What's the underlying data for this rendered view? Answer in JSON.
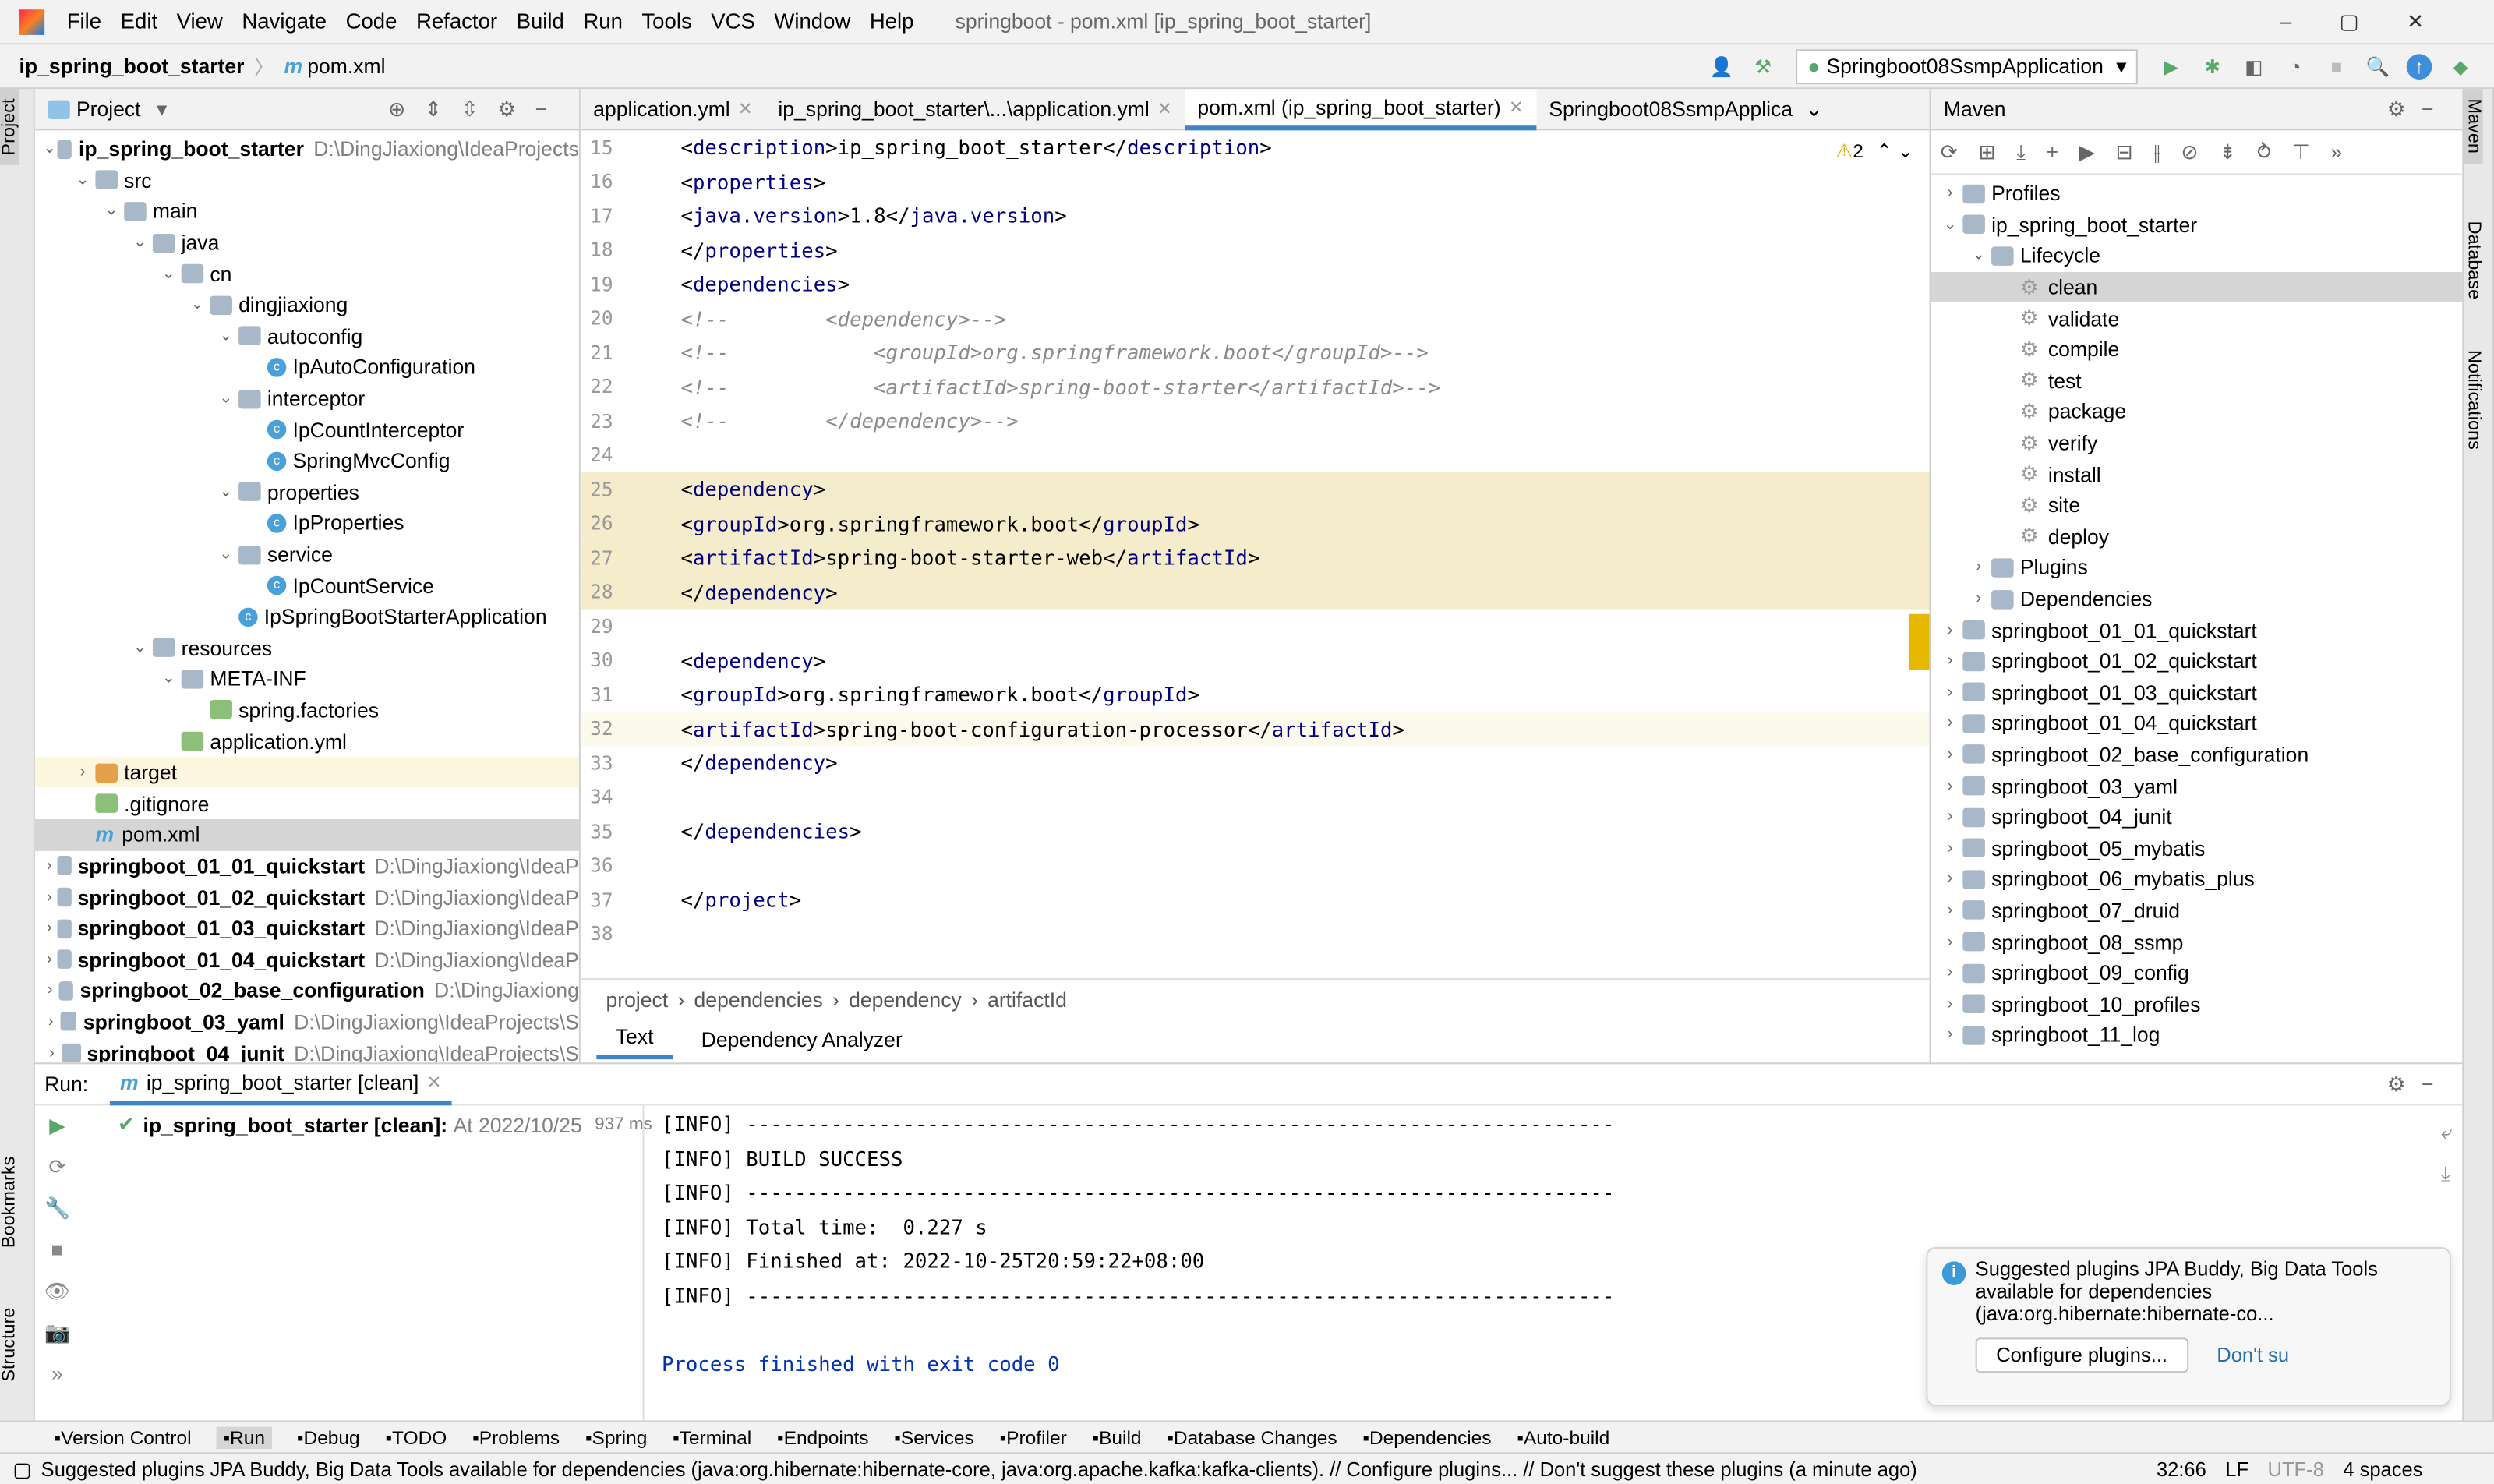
{
  "menu": [
    "File",
    "Edit",
    "View",
    "Navigate",
    "Code",
    "Refactor",
    "Build",
    "Run",
    "Tools",
    "VCS",
    "Window",
    "Help"
  ],
  "window_title": "springboot - pom.xml [ip_spring_boot_starter]",
  "breadcrumb": {
    "project": "ip_spring_boot_starter",
    "file": "pom.xml"
  },
  "run_config": "Springboot08SsmpApplication",
  "left_stripe": {
    "project": "Project",
    "bookmarks": "Bookmarks",
    "structure": "Structure"
  },
  "right_stripe": {
    "maven": "Maven",
    "database": "Database",
    "notifications": "Notifications"
  },
  "project_panel": {
    "title": "Project",
    "tree": [
      {
        "d": 0,
        "o": "v",
        "i": "folder",
        "t": "ip_spring_boot_starter",
        "b": true,
        "p": "D:\\DingJiaxiong\\IdeaProjects"
      },
      {
        "d": 1,
        "o": "v",
        "i": "folder",
        "t": "src"
      },
      {
        "d": 2,
        "o": "v",
        "i": "folder",
        "t": "main"
      },
      {
        "d": 3,
        "o": "v",
        "i": "folder",
        "t": "java"
      },
      {
        "d": 4,
        "o": "v",
        "i": "folder",
        "t": "cn"
      },
      {
        "d": 5,
        "o": "v",
        "i": "folder",
        "t": "dingjiaxiong"
      },
      {
        "d": 6,
        "o": "v",
        "i": "folder",
        "t": "autoconfig"
      },
      {
        "d": 7,
        "o": "",
        "i": "class",
        "t": "IpAutoConfiguration"
      },
      {
        "d": 6,
        "o": "v",
        "i": "folder",
        "t": "interceptor"
      },
      {
        "d": 7,
        "o": "",
        "i": "class",
        "t": "IpCountInterceptor"
      },
      {
        "d": 7,
        "o": "",
        "i": "class",
        "t": "SpringMvcConfig"
      },
      {
        "d": 6,
        "o": "v",
        "i": "folder",
        "t": "properties"
      },
      {
        "d": 7,
        "o": "",
        "i": "class",
        "t": "IpProperties"
      },
      {
        "d": 6,
        "o": "v",
        "i": "folder",
        "t": "service"
      },
      {
        "d": 7,
        "o": "",
        "i": "class",
        "t": "IpCountService"
      },
      {
        "d": 6,
        "o": "",
        "i": "class",
        "t": "IpSpringBootStarterApplication"
      },
      {
        "d": 3,
        "o": "v",
        "i": "folder",
        "t": "resources"
      },
      {
        "d": 4,
        "o": "v",
        "i": "folder",
        "t": "META-INF"
      },
      {
        "d": 5,
        "o": "",
        "i": "file",
        "t": "spring.factories"
      },
      {
        "d": 4,
        "o": "",
        "i": "file",
        "t": "application.yml"
      },
      {
        "d": 1,
        "o": ">",
        "i": "target",
        "t": "target",
        "hl": true
      },
      {
        "d": 1,
        "o": "",
        "i": "file",
        "t": ".gitignore"
      },
      {
        "d": 1,
        "o": "",
        "i": "maven",
        "t": "pom.xml",
        "sel": true
      },
      {
        "d": 0,
        "o": ">",
        "i": "folder",
        "t": "springboot_01_01_quickstart",
        "b": true,
        "p": "D:\\DingJiaxiong\\IdeaP"
      },
      {
        "d": 0,
        "o": ">",
        "i": "folder",
        "t": "springboot_01_02_quickstart",
        "b": true,
        "p": "D:\\DingJiaxiong\\IdeaP"
      },
      {
        "d": 0,
        "o": ">",
        "i": "folder",
        "t": "springboot_01_03_quickstart",
        "b": true,
        "p": "D:\\DingJiaxiong\\IdeaP"
      },
      {
        "d": 0,
        "o": ">",
        "i": "folder",
        "t": "springboot_01_04_quickstart",
        "b": true,
        "p": "D:\\DingJiaxiong\\IdeaP"
      },
      {
        "d": 0,
        "o": ">",
        "i": "folder",
        "t": "springboot_02_base_configuration",
        "b": true,
        "p": "D:\\DingJiaxiong"
      },
      {
        "d": 0,
        "o": ">",
        "i": "folder",
        "t": "springboot_03_yaml",
        "b": true,
        "p": "D:\\DingJiaxiong\\IdeaProjects\\S"
      },
      {
        "d": 0,
        "o": ">",
        "i": "folder",
        "t": "springboot_04_junit",
        "b": true,
        "p": "D:\\DingJiaxiong\\IdeaProjects\\S"
      }
    ]
  },
  "editor": {
    "tabs": [
      {
        "t": "application.yml"
      },
      {
        "t": "ip_spring_boot_starter\\...\\application.yml"
      },
      {
        "t": "pom.xml (ip_spring_boot_starter)",
        "active": true
      },
      {
        "t": "Springboot08SsmpApplica"
      }
    ],
    "warnings": "2",
    "lines": [
      {
        "n": "15",
        "c": "    <description>ip_spring_boot_starter</description>"
      },
      {
        "n": "16",
        "c": "    <properties>"
      },
      {
        "n": "17",
        "c": "        <java.version>1.8</java.version>"
      },
      {
        "n": "18",
        "c": "    </properties>"
      },
      {
        "n": "19",
        "c": "    <dependencies>"
      },
      {
        "n": "20",
        "c": "<!--        <dependency>-->"
      },
      {
        "n": "21",
        "c": "<!--            <groupId>org.springframework.boot</groupId>-->"
      },
      {
        "n": "22",
        "c": "<!--            <artifactId>spring-boot-starter</artifactId>-->"
      },
      {
        "n": "23",
        "c": "<!--        </dependency>-->"
      },
      {
        "n": "24",
        "c": ""
      },
      {
        "n": "25",
        "c": "        <dependency>",
        "hl": true
      },
      {
        "n": "26",
        "c": "            <groupId>org.springframework.boot</groupId>",
        "hl": true
      },
      {
        "n": "27",
        "c": "            <artifactId>spring-boot-starter-web</artifactId>",
        "hl": true
      },
      {
        "n": "28",
        "c": "        </dependency>",
        "hl": true
      },
      {
        "n": "29",
        "c": ""
      },
      {
        "n": "30",
        "c": "        <dependency>"
      },
      {
        "n": "31",
        "c": "            <groupId>org.springframework.boot</groupId>"
      },
      {
        "n": "32",
        "c": "            <artifactId>spring-boot-configuration-processor</artifactId>",
        "cur": true
      },
      {
        "n": "33",
        "c": "        </dependency>"
      },
      {
        "n": "34",
        "c": ""
      },
      {
        "n": "35",
        "c": "    </dependencies>"
      },
      {
        "n": "36",
        "c": ""
      },
      {
        "n": "37",
        "c": "</project>"
      },
      {
        "n": "38",
        "c": ""
      }
    ],
    "breadcrumbs": [
      "project",
      "dependencies",
      "dependency",
      "artifactId"
    ],
    "bottom_tabs": [
      {
        "t": "Text",
        "active": true
      },
      {
        "t": "Dependency Analyzer"
      }
    ]
  },
  "maven": {
    "title": "Maven",
    "tree": [
      {
        "d": 0,
        "o": ">",
        "t": "Profiles"
      },
      {
        "d": 0,
        "o": "v",
        "t": "ip_spring_boot_starter"
      },
      {
        "d": 1,
        "o": "v",
        "t": "Lifecycle"
      },
      {
        "d": 2,
        "o": "",
        "t": "clean",
        "g": true,
        "sel": true
      },
      {
        "d": 2,
        "o": "",
        "t": "validate",
        "g": true
      },
      {
        "d": 2,
        "o": "",
        "t": "compile",
        "g": true
      },
      {
        "d": 2,
        "o": "",
        "t": "test",
        "g": true
      },
      {
        "d": 2,
        "o": "",
        "t": "package",
        "g": true
      },
      {
        "d": 2,
        "o": "",
        "t": "verify",
        "g": true
      },
      {
        "d": 2,
        "o": "",
        "t": "install",
        "g": true
      },
      {
        "d": 2,
        "o": "",
        "t": "site",
        "g": true
      },
      {
        "d": 2,
        "o": "",
        "t": "deploy",
        "g": true
      },
      {
        "d": 1,
        "o": ">",
        "t": "Plugins"
      },
      {
        "d": 1,
        "o": ">",
        "t": "Dependencies"
      },
      {
        "d": 0,
        "o": ">",
        "t": "springboot_01_01_quickstart"
      },
      {
        "d": 0,
        "o": ">",
        "t": "springboot_01_02_quickstart"
      },
      {
        "d": 0,
        "o": ">",
        "t": "springboot_01_03_quickstart"
      },
      {
        "d": 0,
        "o": ">",
        "t": "springboot_01_04_quickstart"
      },
      {
        "d": 0,
        "o": ">",
        "t": "springboot_02_base_configuration"
      },
      {
        "d": 0,
        "o": ">",
        "t": "springboot_03_yaml"
      },
      {
        "d": 0,
        "o": ">",
        "t": "springboot_04_junit"
      },
      {
        "d": 0,
        "o": ">",
        "t": "springboot_05_mybatis"
      },
      {
        "d": 0,
        "o": ">",
        "t": "springboot_06_mybatis_plus"
      },
      {
        "d": 0,
        "o": ">",
        "t": "springboot_07_druid"
      },
      {
        "d": 0,
        "o": ">",
        "t": "springboot_08_ssmp"
      },
      {
        "d": 0,
        "o": ">",
        "t": "springboot_09_config"
      },
      {
        "d": 0,
        "o": ">",
        "t": "springboot_10_profiles"
      },
      {
        "d": 0,
        "o": ">",
        "t": "springboot_11_log"
      }
    ]
  },
  "run": {
    "label": "Run:",
    "tab": "ip_spring_boot_starter [clean]",
    "tree_item": "ip_spring_boot_starter [clean]:",
    "tree_time": "At 2022/10/25",
    "tree_ms": "937 ms",
    "console": [
      "[INFO] ------------------------------------------------------------------------",
      "[INFO] BUILD SUCCESS",
      "[INFO] ------------------------------------------------------------------------",
      "[INFO] Total time:  0.227 s",
      "[INFO] Finished at: 2022-10-25T20:59:22+08:00",
      "[INFO] ------------------------------------------------------------------------",
      ""
    ],
    "exit": "Process finished with exit code 0"
  },
  "notification": {
    "text1": "Suggested plugins JPA Buddy, Big Data Tools",
    "text2": "available for dependencies",
    "text3": "(java:org.hibernate:hibernate-co...",
    "configure": "Configure plugins...",
    "dont": "Don't su"
  },
  "bottombar": [
    "Version Control",
    "Run",
    "Debug",
    "TODO",
    "Problems",
    "Spring",
    "Terminal",
    "Endpoints",
    "Services",
    "Profiler",
    "Build",
    "Database Changes",
    "Dependencies",
    "Auto-build"
  ],
  "status": {
    "message": "Suggested plugins JPA Buddy, Big Data Tools available for dependencies (java:org.hibernate:hibernate-core, java:org.apache.kafka:kafka-clients). // Configure plugins... // Don't suggest these plugins (a minute ago)",
    "position": "32:66",
    "line_sep": "LF",
    "encoding": "UTF-8",
    "indent": "4 spaces"
  },
  "colors": {
    "accent": "#4083c9",
    "tag": "#000080",
    "comment": "#8c8c8c",
    "highlight": "#f5eccb",
    "run_green": "#59a869"
  }
}
